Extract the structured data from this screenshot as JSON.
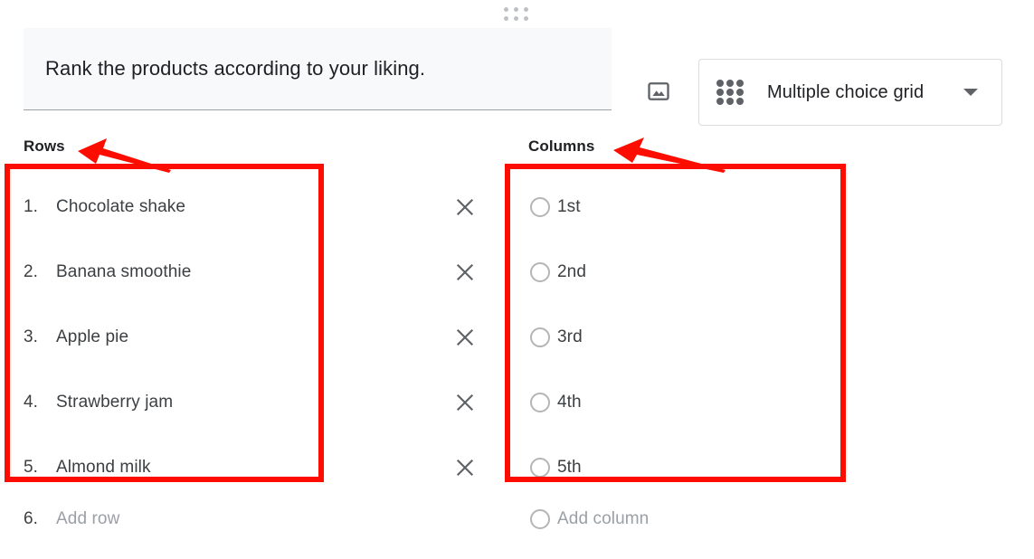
{
  "header": {
    "drag_handle_icon": "drag-handle-dots-icon",
    "question_text": "Rank the products according to your liking.",
    "image_button_icon": "image-icon",
    "question_type": {
      "icon": "grid-3x3-icon",
      "label": "Multiple choice grid",
      "caret_icon": "chevron-down-icon"
    }
  },
  "rows_section": {
    "label": "Rows",
    "items": [
      {
        "number": "1.",
        "text": "Chocolate shake"
      },
      {
        "number": "2.",
        "text": "Banana smoothie"
      },
      {
        "number": "3.",
        "text": "Apple pie"
      },
      {
        "number": "4.",
        "text": "Strawberry jam"
      },
      {
        "number": "5.",
        "text": "Almond milk"
      }
    ],
    "add": {
      "number": "6.",
      "text": "Add row"
    },
    "remove_icon": "close-x-icon"
  },
  "columns_section": {
    "label": "Columns",
    "items": [
      {
        "text": "1st"
      },
      {
        "text": "2nd"
      },
      {
        "text": "3rd"
      },
      {
        "text": "4th"
      },
      {
        "text": "5th"
      }
    ],
    "add": {
      "text": "Add column"
    },
    "radio_icon": "radio-button-unchecked-icon",
    "remove_icon": "close-x-icon"
  },
  "annotations": {
    "highlight_color": "#fc0d00",
    "rows_arrow_icon": "red-arrow-pointing-left-icon",
    "columns_arrow_icon": "red-arrow-pointing-left-icon"
  },
  "colors": {
    "field_background": "#f8f9fa",
    "text_primary": "#202124",
    "text_secondary": "#3c4043",
    "placeholder": "#9aa0a6",
    "border": "#dadce0",
    "icon_gray": "#5f6368"
  }
}
